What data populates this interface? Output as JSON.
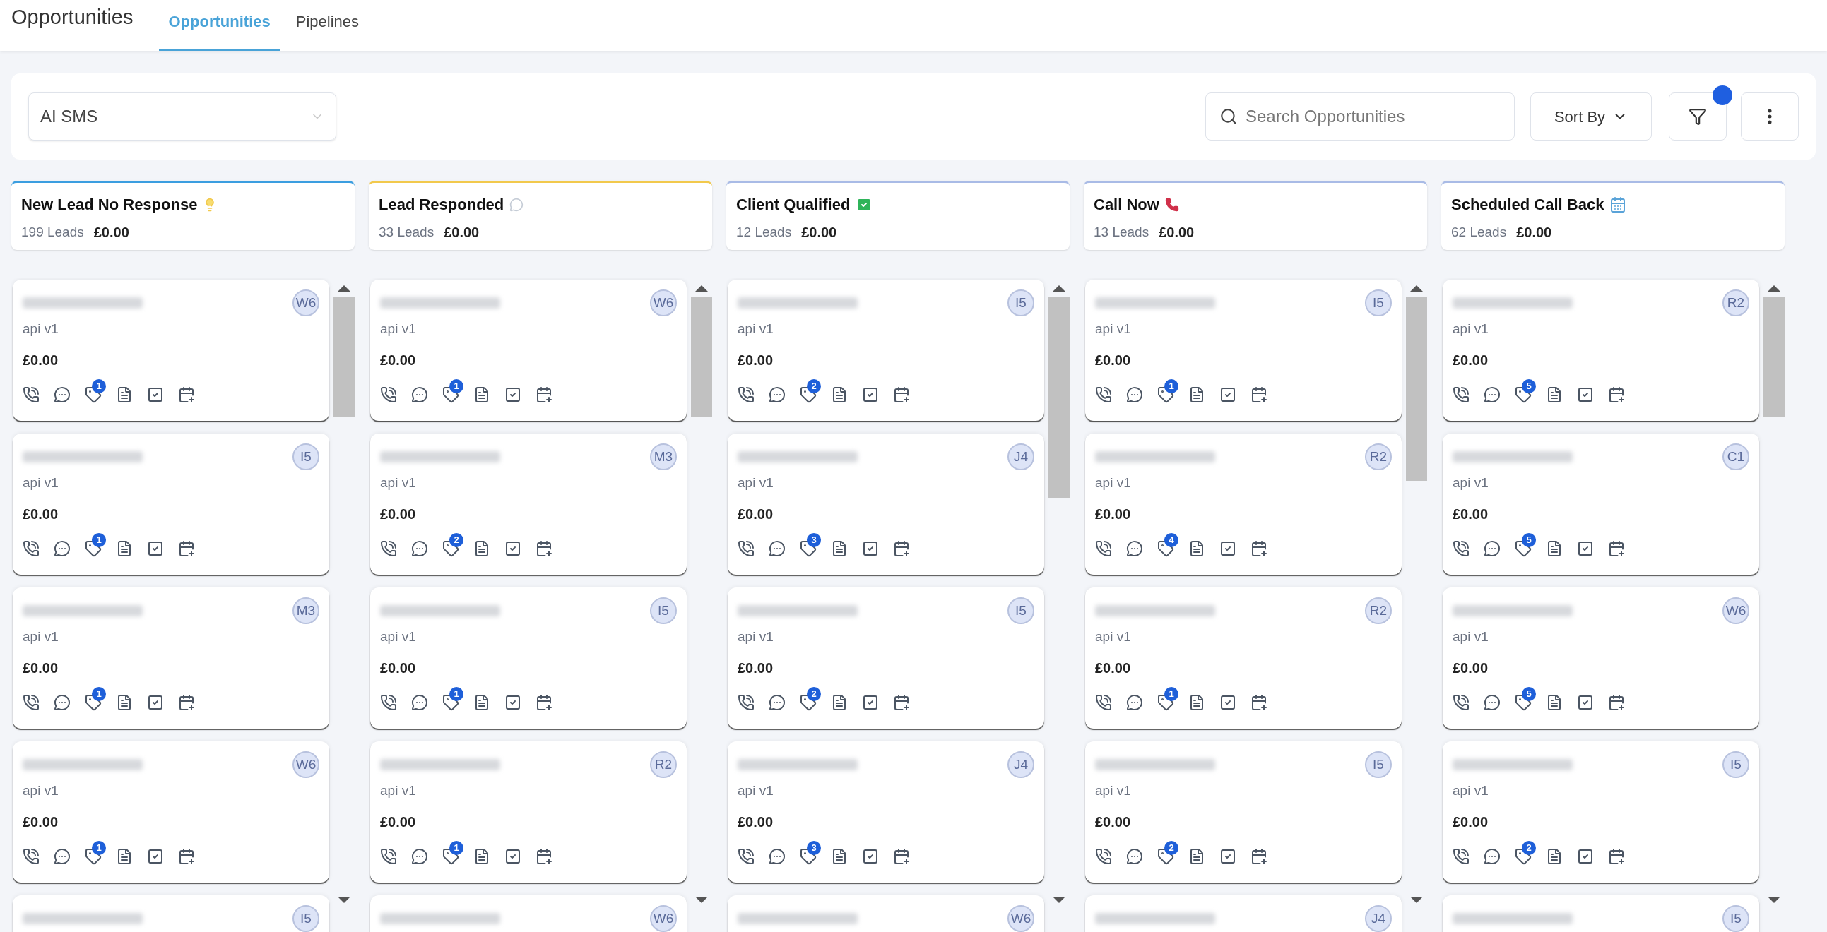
{
  "page_title": "Opportunities",
  "tabs": [
    {
      "label": "Opportunities",
      "selected": true
    },
    {
      "label": "Pipelines",
      "selected": false
    }
  ],
  "pipeline_select": {
    "value": "AI SMS"
  },
  "search": {
    "placeholder": "Search Opportunities"
  },
  "sort_button": {
    "label": "Sort By"
  },
  "filter_button": {
    "active": true
  },
  "columns": [
    {
      "title": "New Lead No Response",
      "kind": "bulb",
      "color": "#3b9ee0",
      "count": "199 Leads",
      "total": "£0.00",
      "cards": [
        {
          "source": "api v1",
          "value": "£0.00",
          "initials": "W6",
          "tags": "1"
        },
        {
          "source": "api v1",
          "value": "£0.00",
          "initials": "I5",
          "tags": "1"
        },
        {
          "source": "api v1",
          "value": "£0.00",
          "initials": "M3",
          "tags": "1"
        },
        {
          "source": "api v1",
          "value": "£0.00",
          "initials": "W6",
          "tags": "1"
        },
        {
          "initials": "I5"
        }
      ]
    },
    {
      "title": "Lead Responded",
      "kind": "speech",
      "color": "#f2c94c",
      "count": "33 Leads",
      "total": "£0.00",
      "cards": [
        {
          "source": "api v1",
          "value": "£0.00",
          "initials": "W6",
          "tags": "1"
        },
        {
          "source": "api v1",
          "value": "£0.00",
          "initials": "M3",
          "tags": "2"
        },
        {
          "source": "api v1",
          "value": "£0.00",
          "initials": "I5",
          "tags": "1"
        },
        {
          "source": "api v1",
          "value": "£0.00",
          "initials": "R2",
          "tags": "1"
        },
        {
          "initials": "W6"
        }
      ]
    },
    {
      "title": "Client Qualified",
      "kind": "check",
      "color": "#a9bbe6",
      "count": "12 Leads",
      "total": "£0.00",
      "cards": [
        {
          "source": "api v1",
          "value": "£0.00",
          "initials": "I5",
          "tags": "2"
        },
        {
          "source": "api v1",
          "value": "£0.00",
          "initials": "J4",
          "tags": "3"
        },
        {
          "source": "api v1",
          "value": "£0.00",
          "initials": "I5",
          "tags": "2"
        },
        {
          "source": "api v1",
          "value": "£0.00",
          "initials": "J4",
          "tags": "3"
        },
        {
          "initials": "W6"
        }
      ]
    },
    {
      "title": "Call Now",
      "kind": "phone",
      "color": "#a9bbe6",
      "count": "13 Leads",
      "total": "£0.00",
      "cards": [
        {
          "source": "api v1",
          "value": "£0.00",
          "initials": "I5",
          "tags": "1"
        },
        {
          "source": "api v1",
          "value": "£0.00",
          "initials": "R2",
          "tags": "4"
        },
        {
          "source": "api v1",
          "value": "£0.00",
          "initials": "R2",
          "tags": "1"
        },
        {
          "source": "api v1",
          "value": "£0.00",
          "initials": "I5",
          "tags": "2"
        },
        {
          "initials": "J4"
        }
      ]
    },
    {
      "title": "Scheduled Call Back",
      "kind": "calendar",
      "color": "#a9bbe6",
      "count": "62 Leads",
      "total": "£0.00",
      "cards": [
        {
          "source": "api v1",
          "value": "£0.00",
          "initials": "R2",
          "tags": "5"
        },
        {
          "source": "api v1",
          "value": "£0.00",
          "initials": "C1",
          "tags": "5"
        },
        {
          "source": "api v1",
          "value": "£0.00",
          "initials": "W6",
          "tags": "5"
        },
        {
          "source": "api v1",
          "value": "£0.00",
          "initials": "I5",
          "tags": "2"
        },
        {
          "initials": "I5"
        }
      ]
    }
  ]
}
